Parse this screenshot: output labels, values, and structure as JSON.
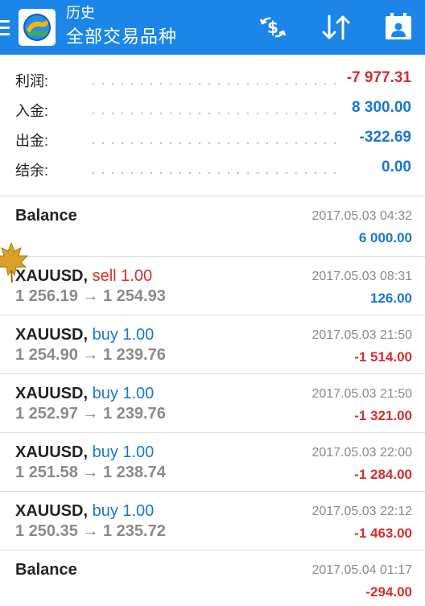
{
  "header": {
    "title": "历史",
    "subtitle": "全部交易品种",
    "background": "#1b86e8"
  },
  "summary": [
    {
      "label": "利润:",
      "value": "-7 977.31",
      "color": "#d32f2f"
    },
    {
      "label": "入金:",
      "value": "8 300.00",
      "color": "#1976d2"
    },
    {
      "label": "出金:",
      "value": "-322.69",
      "color": "#1976d2"
    },
    {
      "label": "结余:",
      "value": "0.00",
      "color": "#1976d2"
    }
  ],
  "arrow": "→",
  "entries": [
    {
      "kind": "balance",
      "title": "Balance",
      "date": "2017.05.03 04:32",
      "profit": "6 000.00",
      "profit_color": "#1976d2"
    },
    {
      "kind": "trade",
      "symbol": "XAUUSD,",
      "type": "sell 1.00",
      "type_color": "#d32f2f",
      "open": "1 256.19",
      "close": "1 254.93",
      "date": "2017.05.03 08:31",
      "profit": "126.00",
      "profit_color": "#1976d2"
    },
    {
      "kind": "trade",
      "symbol": "XAUUSD,",
      "type": "buy 1.00",
      "type_color": "#1976d2",
      "open": "1 254.90",
      "close": "1 239.76",
      "date": "2017.05.03 21:50",
      "profit": "-1 514.00",
      "profit_color": "#d32f2f"
    },
    {
      "kind": "trade",
      "symbol": "XAUUSD,",
      "type": "buy 1.00",
      "type_color": "#1976d2",
      "open": "1 252.97",
      "close": "1 239.76",
      "date": "2017.05.03 21:50",
      "profit": "-1 321.00",
      "profit_color": "#d32f2f"
    },
    {
      "kind": "trade",
      "symbol": "XAUUSD,",
      "type": "buy 1.00",
      "type_color": "#1976d2",
      "open": "1 251.58",
      "close": "1 238.74",
      "date": "2017.05.03 22:00",
      "profit": "-1 284.00",
      "profit_color": "#d32f2f"
    },
    {
      "kind": "trade",
      "symbol": "XAUUSD,",
      "type": "buy 1.00",
      "type_color": "#1976d2",
      "open": "1 250.35",
      "close": "1 235.72",
      "date": "2017.05.03 22:12",
      "profit": "-1 463.00",
      "profit_color": "#d32f2f"
    },
    {
      "kind": "balance",
      "title": "Balance",
      "date": "2017.05.04 01:17",
      "profit": "-294.00",
      "profit_color": "#d32f2f"
    }
  ],
  "icons": [
    "menu-icon",
    "app-logo",
    "exchange-dollar-icon",
    "sort-icon",
    "calendar-icon",
    "maple-leaf-icon"
  ]
}
